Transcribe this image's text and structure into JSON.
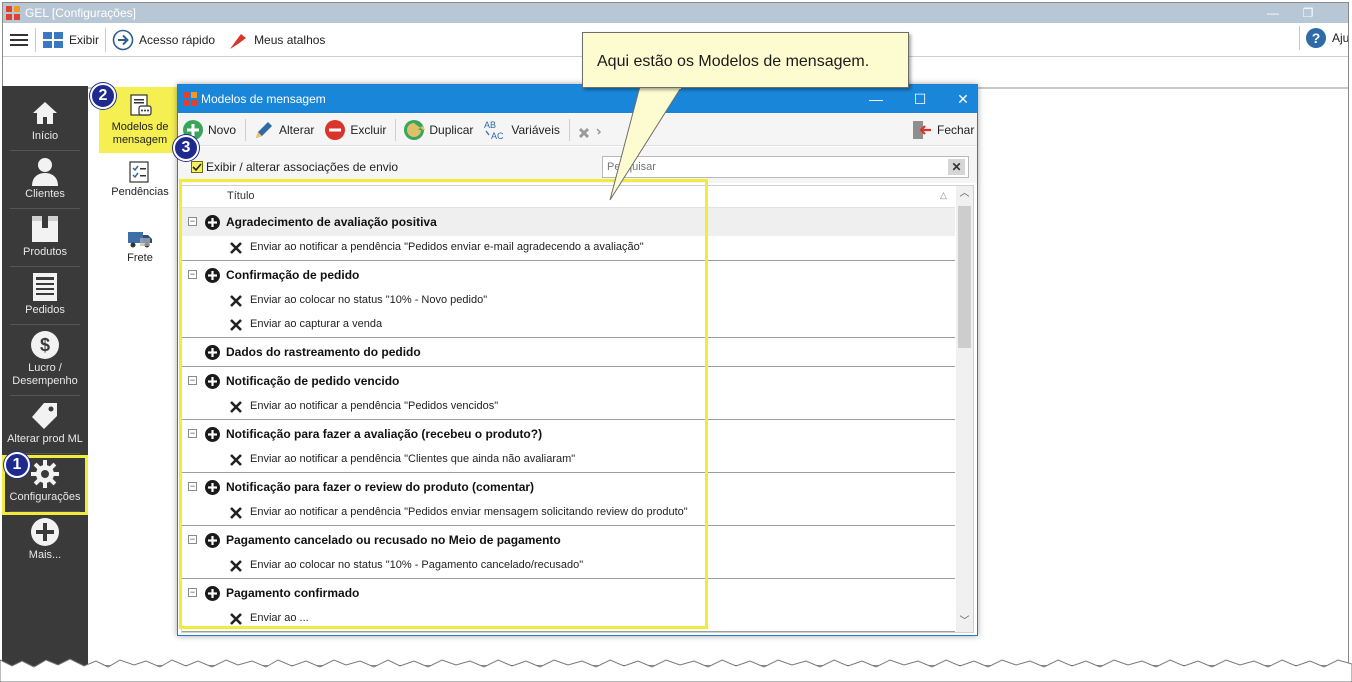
{
  "window": {
    "title": "GEL [Configurações]",
    "help_label": "Aju"
  },
  "menubar": {
    "exibir": "Exibir",
    "acesso_rapido": "Acesso rápido",
    "meus_atalhos": "Meus atalhos"
  },
  "sidebar": {
    "items": [
      {
        "label": "Início",
        "icon": "home-icon"
      },
      {
        "label": "Clientes",
        "icon": "person-icon"
      },
      {
        "label": "Produtos",
        "icon": "box-icon"
      },
      {
        "label": "Pedidos",
        "icon": "document-icon"
      },
      {
        "label": "Lucro / Desempenho",
        "icon": "dollar-icon"
      },
      {
        "label": "Alterar prod ML",
        "icon": "tag-icon"
      },
      {
        "label": "Configurações",
        "icon": "gear-icon"
      },
      {
        "label": "Mais...",
        "icon": "plus-icon"
      }
    ]
  },
  "subpanel": {
    "modelos": "Modelos de mensagem",
    "pendencias": "Pendências",
    "frete": "Frete"
  },
  "dialog": {
    "title": "Modelos de mensagem",
    "toolbar": {
      "novo": "Novo",
      "alterar": "Alterar",
      "excluir": "Excluir",
      "duplicar": "Duplicar",
      "variaveis": "Variáveis",
      "fechar": "Fechar"
    },
    "assoc_label": "Exibir / alterar associações de envio",
    "search_placeholder": "Pesquisar",
    "column_title": "Título",
    "groups": [
      {
        "title": "Agradecimento de avaliação positiva",
        "highlight": true,
        "children": [
          "Enviar ao notificar a pendência \"Pedidos enviar e-mail agradecendo a avaliação\""
        ]
      },
      {
        "title": "Confirmação de pedido",
        "highlight": false,
        "children": [
          "Enviar ao colocar no status \"10% - Novo pedido\"",
          "Enviar ao capturar a venda"
        ]
      },
      {
        "title": "Dados do rastreamento do pedido",
        "highlight": false,
        "children": []
      },
      {
        "title": "Notificação de pedido vencido",
        "highlight": false,
        "children": [
          "Enviar ao notificar a pendência \"Pedidos vencidos\""
        ]
      },
      {
        "title": "Notificação para fazer a avaliação (recebeu o produto?)",
        "highlight": false,
        "children": [
          "Enviar ao notificar a pendência \"Clientes que ainda não avaliaram\""
        ]
      },
      {
        "title": "Notificação para fazer o review do produto (comentar)",
        "highlight": false,
        "children": [
          "Enviar ao notificar a pendência \"Pedidos enviar mensagem solicitando review do produto\""
        ]
      },
      {
        "title": "Pagamento cancelado ou recusado no Meio de pagamento",
        "highlight": false,
        "children": [
          "Enviar ao colocar no status \"10% - Pagamento cancelado/recusado\""
        ]
      },
      {
        "title": "Pagamento confirmado",
        "highlight": false,
        "children": [
          "Enviar ao ..."
        ]
      }
    ]
  },
  "callout": {
    "text": "Aqui estão os Modelos de mensagem."
  },
  "badges": [
    "1",
    "2",
    "3"
  ],
  "colors": {
    "highlight": "#f1ec3c",
    "dialog_blue": "#1a86d9",
    "sidebar": "#3a3a3a",
    "badge": "#1f2a8f"
  }
}
